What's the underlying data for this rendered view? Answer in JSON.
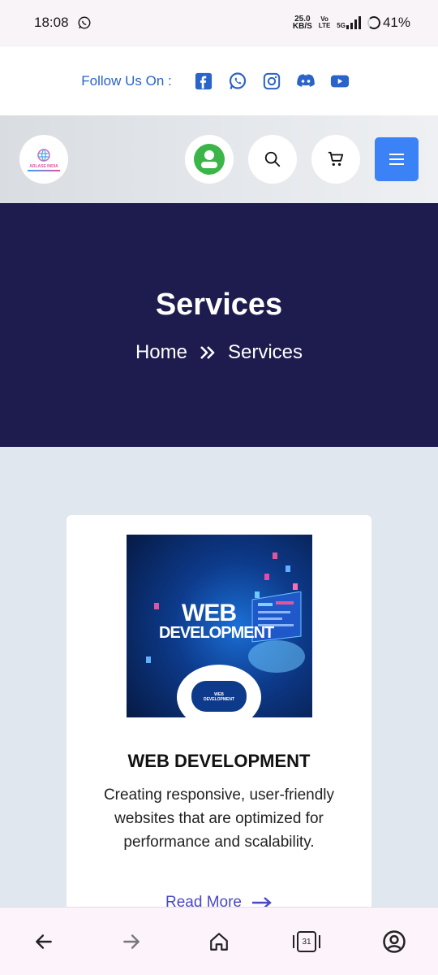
{
  "status_bar": {
    "time": "18:08",
    "net_speed_value": "25.0",
    "net_speed_unit": "KB/S",
    "volte_top": "Vo",
    "volte_bottom": "LTE",
    "network": "5G",
    "battery": "41%"
  },
  "follow": {
    "label": "Follow Us On :",
    "icons": [
      "facebook-icon",
      "whatsapp-icon",
      "instagram-icon",
      "discord-icon",
      "youtube-icon"
    ],
    "accent": "#2a63c9"
  },
  "header": {
    "logo_text": "ARLASE INDIA",
    "menu_color": "#3b82f6"
  },
  "hero": {
    "title": "Services",
    "breadcrumb_home": "Home",
    "breadcrumb_current": "Services",
    "background": "#1e1b4f"
  },
  "card": {
    "image_title_line1": "WEB",
    "image_title_line2": "DEVELOPMENT",
    "image_badge_line1": "WEB",
    "image_badge_line2": "DEVELOPMENT",
    "title": "WEB DEVELOPMENT",
    "description": "Creating responsive, user-friendly websites that are optimized for performance and scalability.",
    "read_more": "Read More"
  },
  "bottom_nav": {
    "tab_count": "31"
  }
}
